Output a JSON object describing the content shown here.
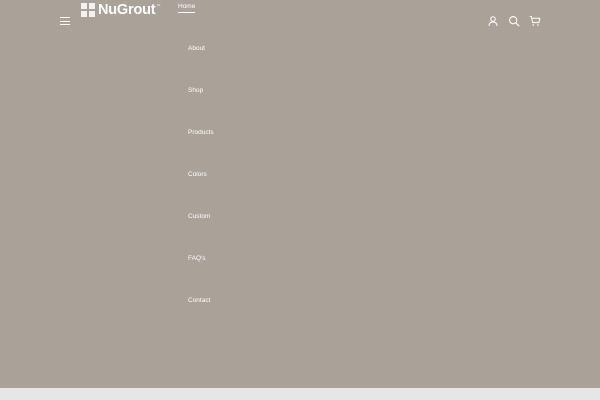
{
  "brand": {
    "name": "NuGrout",
    "trademark": "™"
  },
  "nav": {
    "items": [
      {
        "label": "Home"
      },
      {
        "label": "About"
      },
      {
        "label": "Shop"
      },
      {
        "label": "Products"
      },
      {
        "label": "Colors"
      },
      {
        "label": "Custom"
      },
      {
        "label": "FAQ's"
      },
      {
        "label": "Contact"
      }
    ]
  },
  "header_icons": [
    "menu-icon",
    "account-icon",
    "search-icon",
    "cart-icon"
  ],
  "colors": {
    "hero_background": "#aaa198",
    "page_background": "#e6e6e6",
    "text": "#ffffff"
  }
}
